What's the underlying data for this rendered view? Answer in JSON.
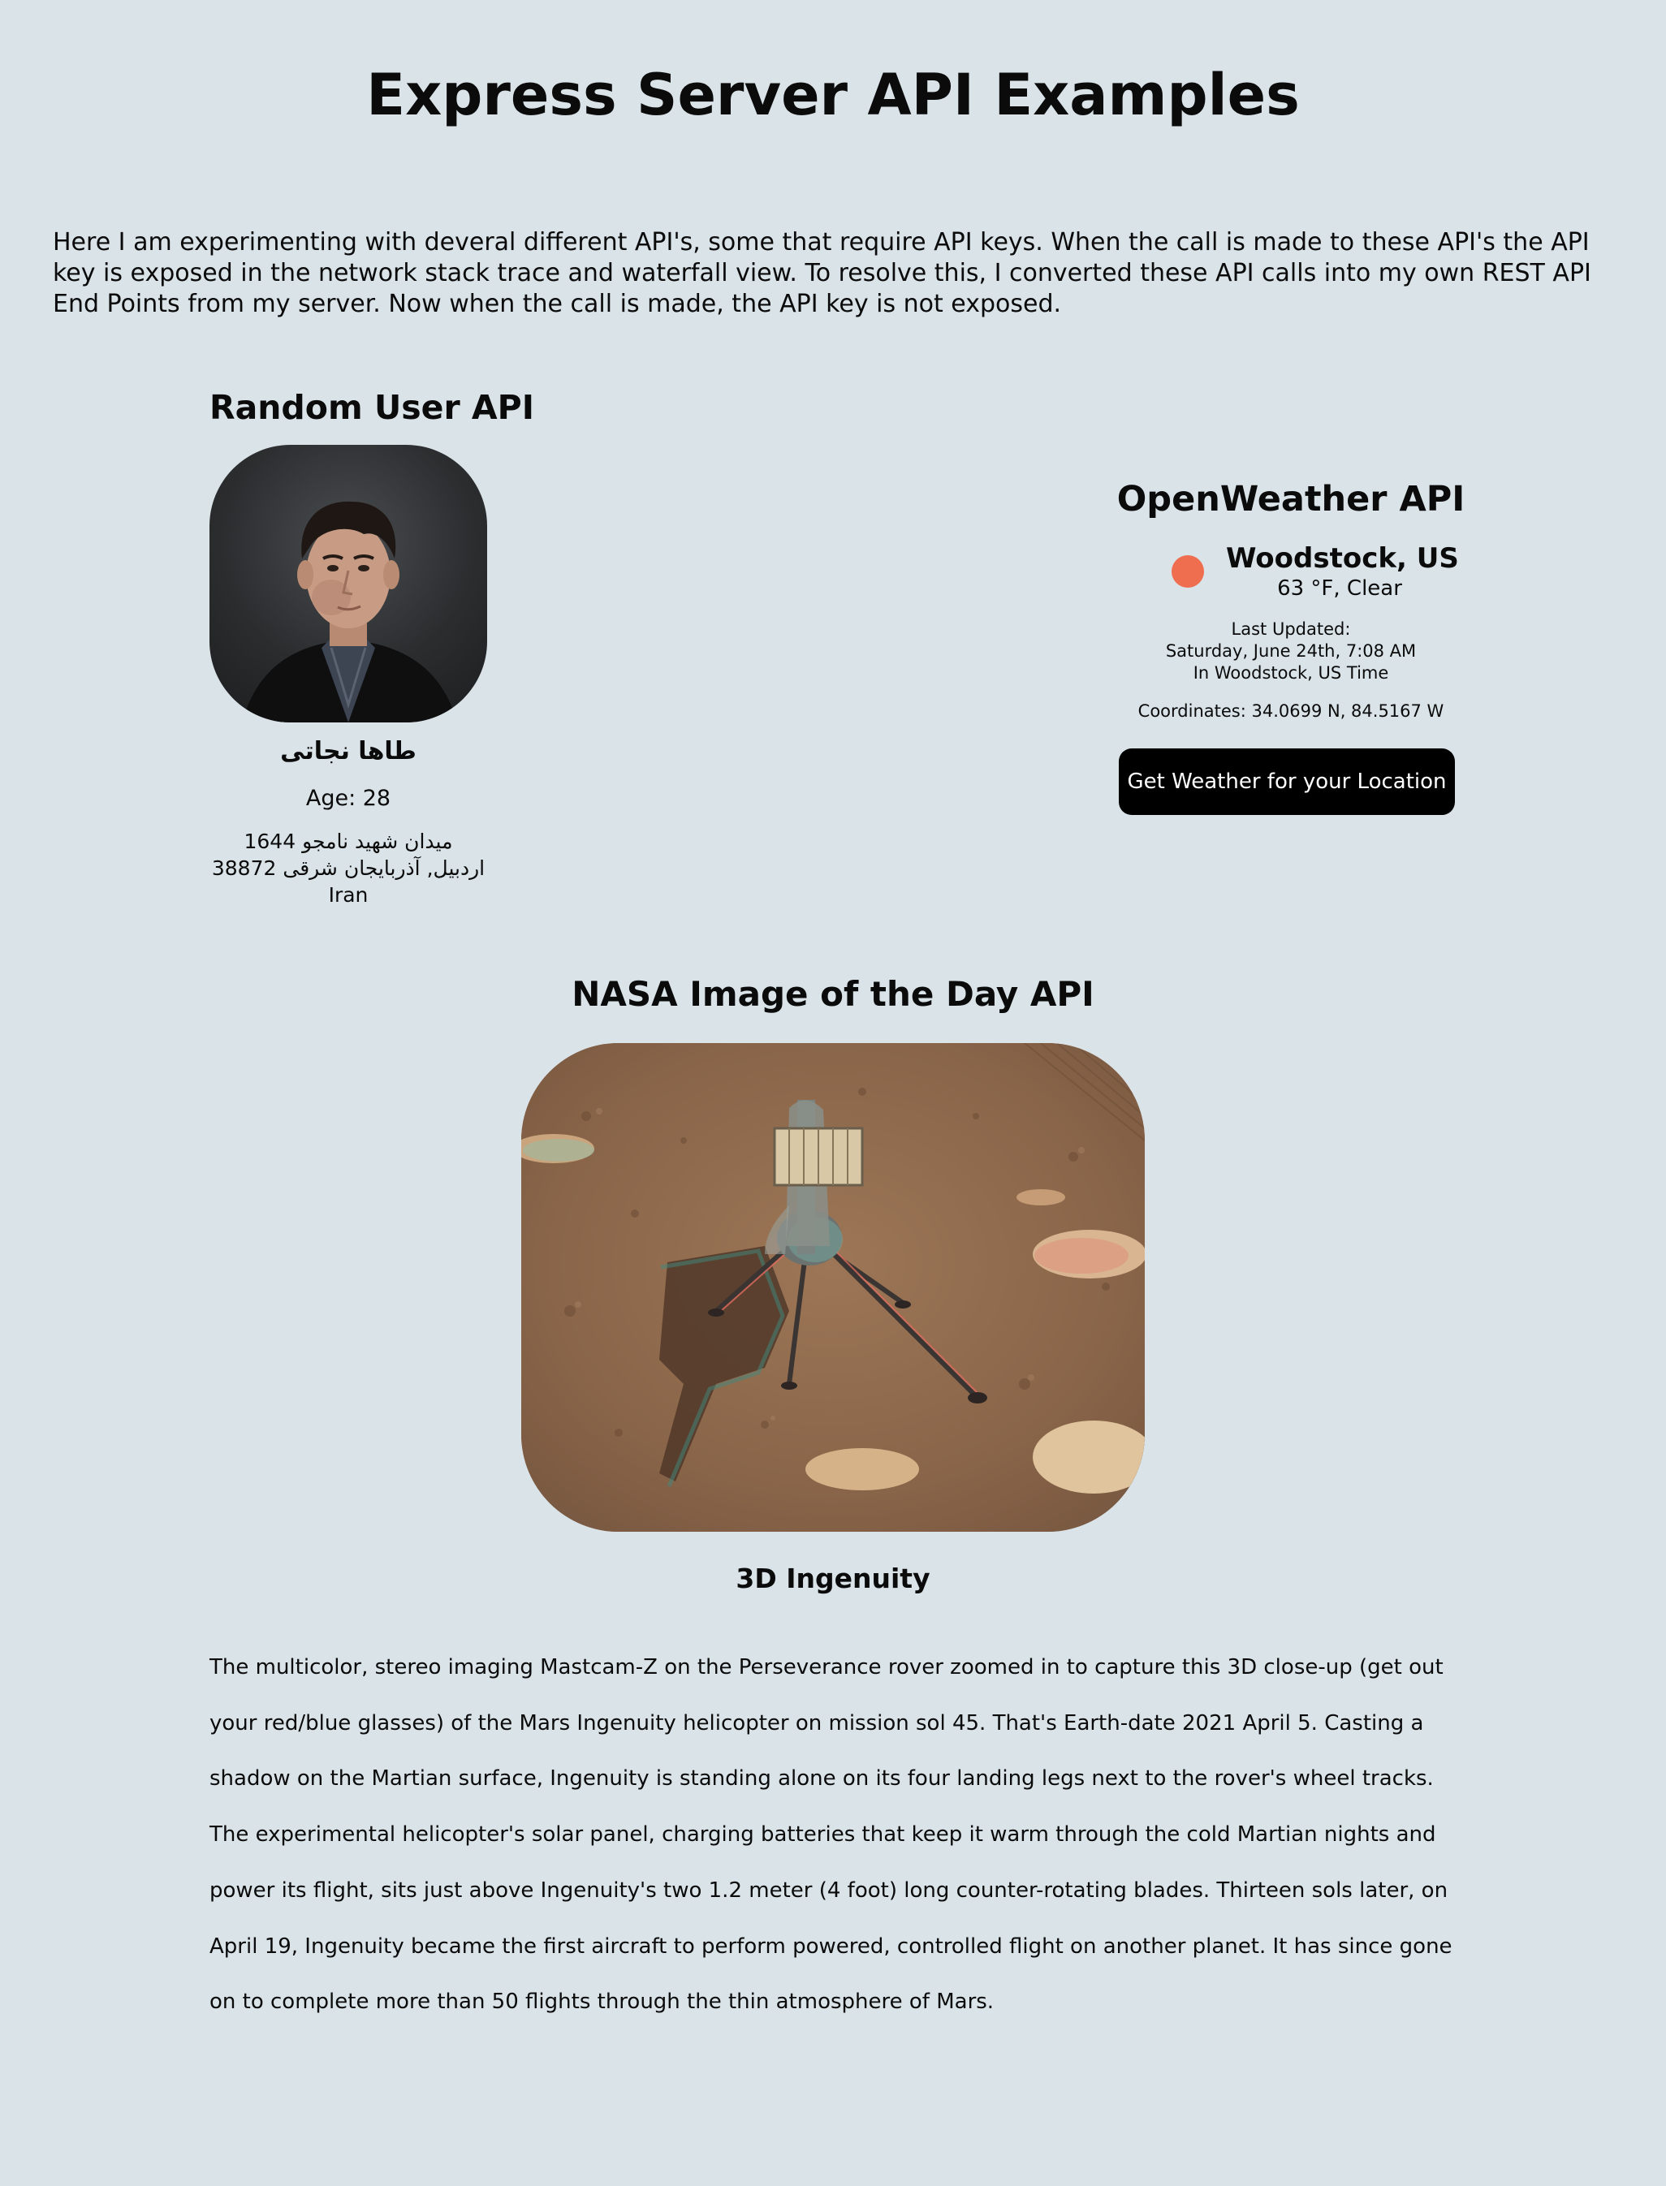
{
  "page": {
    "title": "Express Server API Examples",
    "intro": "Here I am experimenting with deveral different API's, some that require API keys. When the call is made to these API's the API key is exposed in the network stack trace and waterfall view. To resolve this, I converted these API calls into my own REST API End Points from my server. Now when the call is made, the API key is not exposed."
  },
  "random_user": {
    "title": "Random User API",
    "name": "طاها نجاتی",
    "age": "Age: 28",
    "address_line1": "1644 میدان شهید نامجو",
    "address_line2": "اردبیل, آذربایجان شرقی 38872",
    "country": "Iran"
  },
  "weather": {
    "title": "OpenWeather API",
    "city": "Woodstock, US",
    "conditions": "63 °F, Clear",
    "last_updated_label": "Last Updated:",
    "last_updated_time": "Saturday, June 24th, 7:08 AM",
    "timezone_note": "In Woodstock, US Time",
    "coordinates": "Coordinates: 34.0699 N, 84.5167 W",
    "button_label": "Get Weather for your Location",
    "icon_color": "#ee6e4f"
  },
  "nasa": {
    "title": "NASA Image of the Day API",
    "image_title": "3D Ingenuity",
    "description": "The multicolor, stereo imaging Mastcam-Z on the Perseverance rover zoomed in to capture this 3D close-up (get out your red/blue glasses) of the Mars Ingenuity helicopter on mission sol 45. That's Earth-date 2021 April 5. Casting a shadow on the Martian surface, Ingenuity is standing alone on its four landing legs next to the rover's wheel tracks. The experimental helicopter's solar panel, charging batteries that keep it warm through the cold Martian nights and power its flight, sits just above Ingenuity's two 1.2 meter (4 foot) long counter-rotating blades. Thirteen sols later, on April 19, Ingenuity became the first aircraft to perform powered, controlled flight on another planet. It has since gone on to complete more than 50 flights through the thin atmosphere of Mars."
  }
}
